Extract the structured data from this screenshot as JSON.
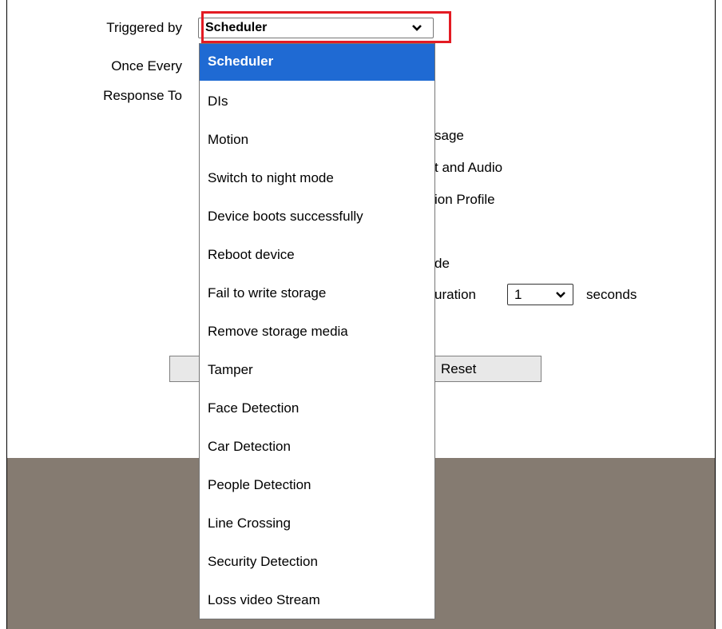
{
  "form": {
    "triggered_by_label": "Triggered by",
    "once_every_label": "Once Every",
    "response_to_label": "Response To",
    "triggered_by_value": "Scheduler"
  },
  "background_fragments": {
    "message": "sage",
    "alert_audio": "t and Audio",
    "profile": "ion Profile",
    "mode": "de",
    "duration": "uration",
    "duration_value": "1",
    "seconds": "seconds",
    "reset": "Reset"
  },
  "dropdown": {
    "options": [
      "Scheduler",
      "DIs",
      "Motion",
      "Switch to night mode",
      "Device boots successfully",
      "Reboot device",
      "Fail to write storage",
      "Remove storage media",
      "Tamper",
      "Face Detection",
      "Car Detection",
      "People Detection",
      "Line Crossing",
      "Security Detection",
      "Loss video Stream"
    ],
    "selected_index": 0
  },
  "colors": {
    "selected": "#1f6ad3",
    "highlight": "#e31b23",
    "band": "#857b71"
  },
  "icons": {
    "dropdown_chevron": "chevron-down-icon"
  }
}
